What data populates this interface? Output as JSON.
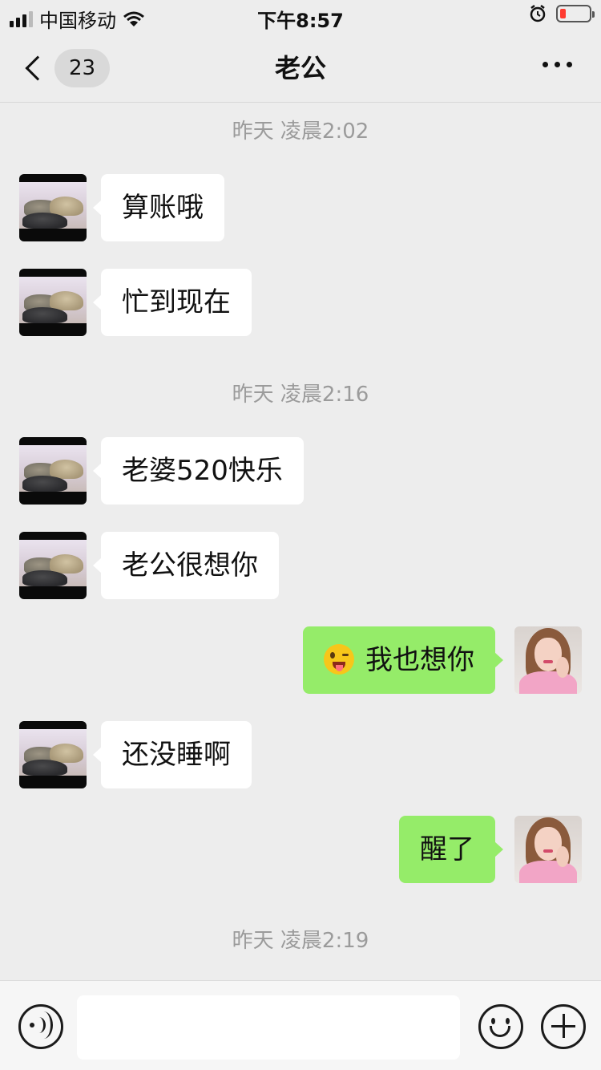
{
  "status_bar": {
    "carrier": "中国移动",
    "time": "下午8:57"
  },
  "nav": {
    "unread_count": "23",
    "title": "老公"
  },
  "timestamps": [
    "昨天 凌晨2:02",
    "昨天 凌晨2:16",
    "昨天 凌晨2:19"
  ],
  "messages": [
    {
      "from": "other",
      "text": "算账哦"
    },
    {
      "from": "other",
      "text": "忙到现在"
    },
    {
      "from": "other",
      "text": "老婆520快乐"
    },
    {
      "from": "other",
      "text": "老公很想你"
    },
    {
      "from": "me",
      "text": "我也想你",
      "emoji": "tongue-wink-emoji"
    },
    {
      "from": "other",
      "text": "还没睡啊"
    },
    {
      "from": "me",
      "text": "醒了"
    }
  ],
  "input_bar": {
    "placeholder": ""
  },
  "colors": {
    "background": "#ededed",
    "sent_bubble": "#95ec69",
    "received_bubble": "#ffffff",
    "timestamp": "#9b9b9b",
    "battery_low": "#ff3b30"
  },
  "icons": [
    "signal-icon",
    "wifi-icon",
    "alarm-icon",
    "battery-icon",
    "back-chevron-icon",
    "more-icon",
    "voice-icon",
    "emoji-icon",
    "plus-icon"
  ]
}
